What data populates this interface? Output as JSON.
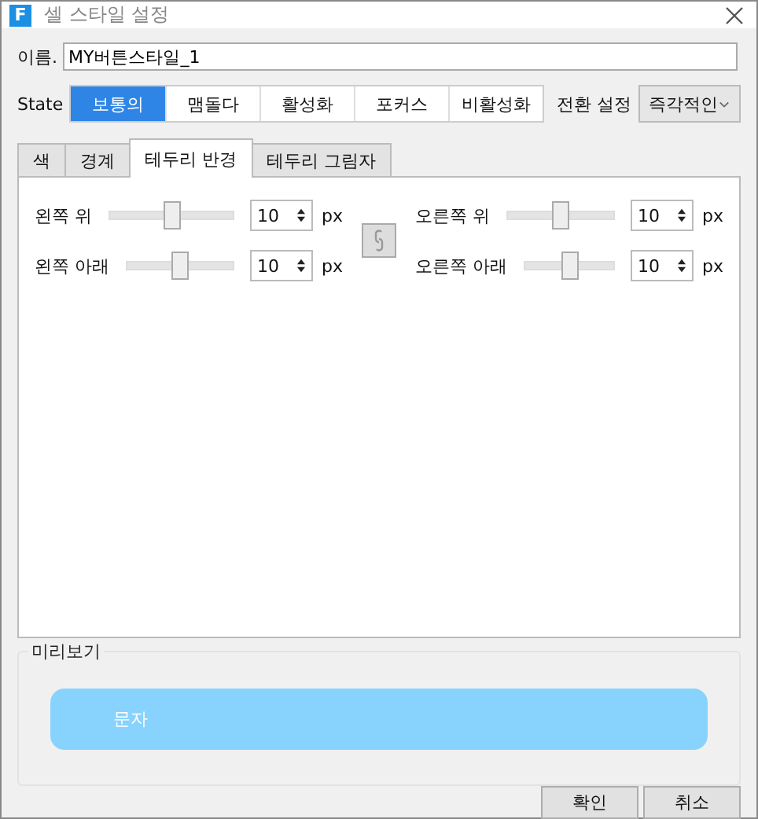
{
  "window": {
    "title": "셀 스타일 설정",
    "app_icon_letter": "F"
  },
  "name_field": {
    "label": "이름.",
    "value": "MY버튼스타일_1"
  },
  "state": {
    "label": "State",
    "options": [
      {
        "label": "보통의",
        "selected": true
      },
      {
        "label": "맴돌다",
        "selected": false
      },
      {
        "label": "활성화",
        "selected": false
      },
      {
        "label": "포커스",
        "selected": false
      },
      {
        "label": "비활성화",
        "selected": false
      }
    ]
  },
  "transition": {
    "label": "전환 설정",
    "value": "즉각적인"
  },
  "tabs": [
    {
      "label": "색",
      "selected": false
    },
    {
      "label": "경계",
      "selected": false
    },
    {
      "label": "테두리 반경",
      "selected": true
    },
    {
      "label": "테두리 그림자",
      "selected": false
    }
  ],
  "corners_left": [
    {
      "label": "왼쪽 위",
      "level": 0.5,
      "value": "10",
      "unit": "px"
    },
    {
      "label": "왼쪽 아래",
      "level": 0.5,
      "value": "10",
      "unit": "px"
    }
  ],
  "corners_right": [
    {
      "label": "오른쪽 위",
      "level": 0.5,
      "value": "10",
      "unit": "px"
    },
    {
      "label": "오른쪽 아래",
      "level": 0.5,
      "value": "10",
      "unit": "px"
    }
  ],
  "preview": {
    "title": "미리보기",
    "text": "문자"
  },
  "buttons": [
    "확인",
    "취소"
  ]
}
